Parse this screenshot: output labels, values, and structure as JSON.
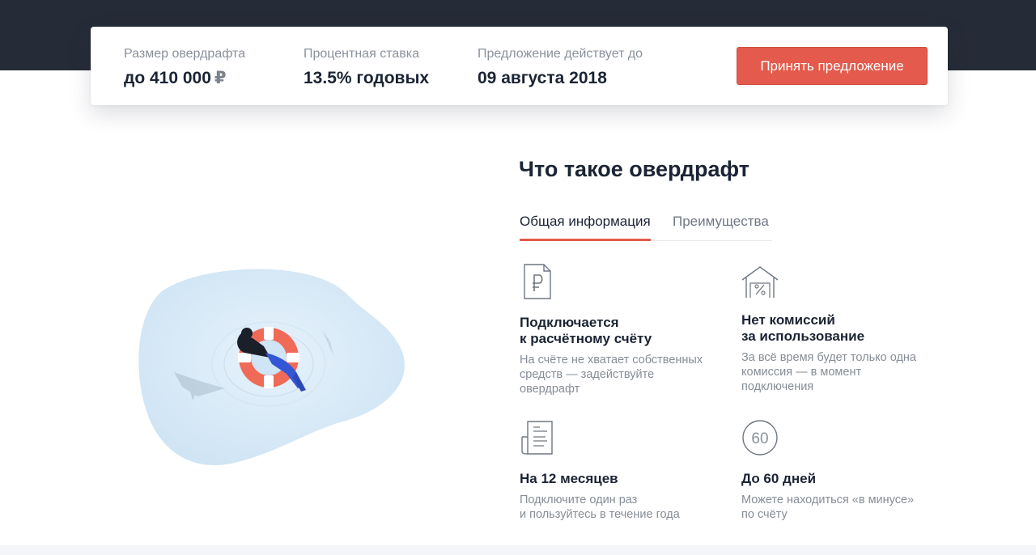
{
  "offer": {
    "overdraft_label": "Размер овердрафта",
    "overdraft_value": "до 410 000",
    "currency_symbol": "₽",
    "rate_label": "Процентная ставка",
    "rate_value": "13.5% годовых",
    "valid_label": "Предложение действует до",
    "valid_value": "09 августа 2018",
    "accept_button": "Принять предложение"
  },
  "section": {
    "title": "Что такое овердрафт",
    "tabs": [
      {
        "label": "Общая информация",
        "active": true
      },
      {
        "label": "Преимущества",
        "active": false
      }
    ]
  },
  "features": [
    {
      "icon": "ruble-document-icon",
      "title_lines": [
        "Подключается",
        "к расчётному счёту"
      ],
      "desc_lines": [
        "На счёте не хватает собственных",
        "средств — задействуйте",
        "овердрафт"
      ]
    },
    {
      "icon": "house-percent-icon",
      "title_lines": [
        "Нет комиссий",
        "за использование"
      ],
      "desc_lines": [
        "За всё время будет только одна",
        "комиссия — в момент",
        "подключения"
      ]
    },
    {
      "icon": "document-icon",
      "title_lines": [
        "На 12 месяцев"
      ],
      "desc_lines": [
        "Подключите один раз",
        "и пользуйтесь в течение года"
      ]
    },
    {
      "icon": "sixty-circle-icon",
      "icon_text": "60",
      "title_lines": [
        "До 60 дней"
      ],
      "desc_lines": [
        "Можете находиться «в минусе»",
        "по счёту"
      ]
    }
  ],
  "colors": {
    "accent": "#e45a4c",
    "header_bg": "#262c37",
    "text_dark": "#1b2434",
    "text_muted": "#868d96"
  }
}
